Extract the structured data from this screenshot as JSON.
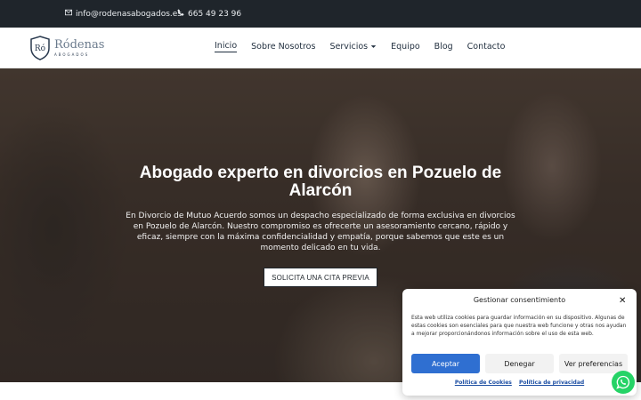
{
  "topbar": {
    "email": "info@rodenasabogados.es",
    "phone": "665 49 23 96",
    "icons": [
      "mail-icon",
      "phone-icon"
    ]
  },
  "header": {
    "logo": {
      "monogram": "Ró",
      "name": "Ródenas",
      "sub": "ABOGADOS"
    },
    "nav": [
      {
        "label": "Inicio",
        "active": true
      },
      {
        "label": "Sobre Nosotros"
      },
      {
        "label": "Servicios",
        "has_dropdown": true
      },
      {
        "label": "Equipo"
      },
      {
        "label": "Blog"
      },
      {
        "label": "Contacto"
      }
    ]
  },
  "hero": {
    "title": "Abogado experto en divorcios en Pozuelo de Alarcón",
    "text": "En Divorcio de Mutuo Acuerdo somos un despacho especializado de forma exclusiva en divorcios en Pozuelo de Alarcón. Nuestro compromiso es ofrecerte un asesoramiento cercano, rápido y eficaz, siempre con la máxima confidencialidad y empatía, porque sabemos que este es un momento delicado en tu vida.",
    "cta": "SOLICITA UNA CITA PREVIA"
  },
  "cookie": {
    "title": "Gestionar consentimiento",
    "text": "Esta web utiliza cookies para guardar información en su dispositivo. Algunas de estas cookies son esenciales para que nuestra web funcione y otras nos ayudan a mejorar proporcionándonos información sobre el uso de esta web.",
    "accept": "Aceptar",
    "deny": "Denegar",
    "prefs": "Ver preferencias",
    "link_cookies": "Política de Cookies",
    "link_privacy": "Política de privacidad"
  },
  "colors": {
    "topbar": "#1f252b",
    "accent": "#2f6fd1",
    "whatsapp": "#25d366"
  }
}
